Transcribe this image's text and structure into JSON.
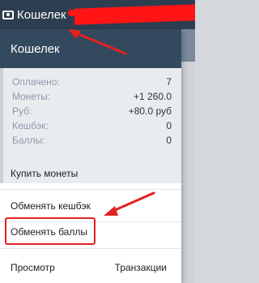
{
  "navbar": {
    "wallet_label": "Кошелек"
  },
  "panel": {
    "title": "Кошелек",
    "stats": [
      {
        "label": "Оплачено:",
        "value": "7"
      },
      {
        "label": "Монеты:",
        "value": "+1 260.0"
      },
      {
        "label": "Руб:",
        "value": "+80.0 руб"
      },
      {
        "label": "Кешбэк:",
        "value": "0"
      },
      {
        "label": "Баллы:",
        "value": "0"
      }
    ],
    "menu": {
      "buy_coins": "Купить монеты",
      "exchange_cashback": "Обменять кешбэк",
      "exchange_points": "Обменять баллы"
    },
    "footer": {
      "view": "Просмотр",
      "transactions": "Транзакции"
    }
  },
  "colors": {
    "navbar_bg": "#2c3e50",
    "panel_header_bg": "#33495e",
    "stats_bg": "#e9ecef",
    "annotation_red": "#e32121"
  }
}
